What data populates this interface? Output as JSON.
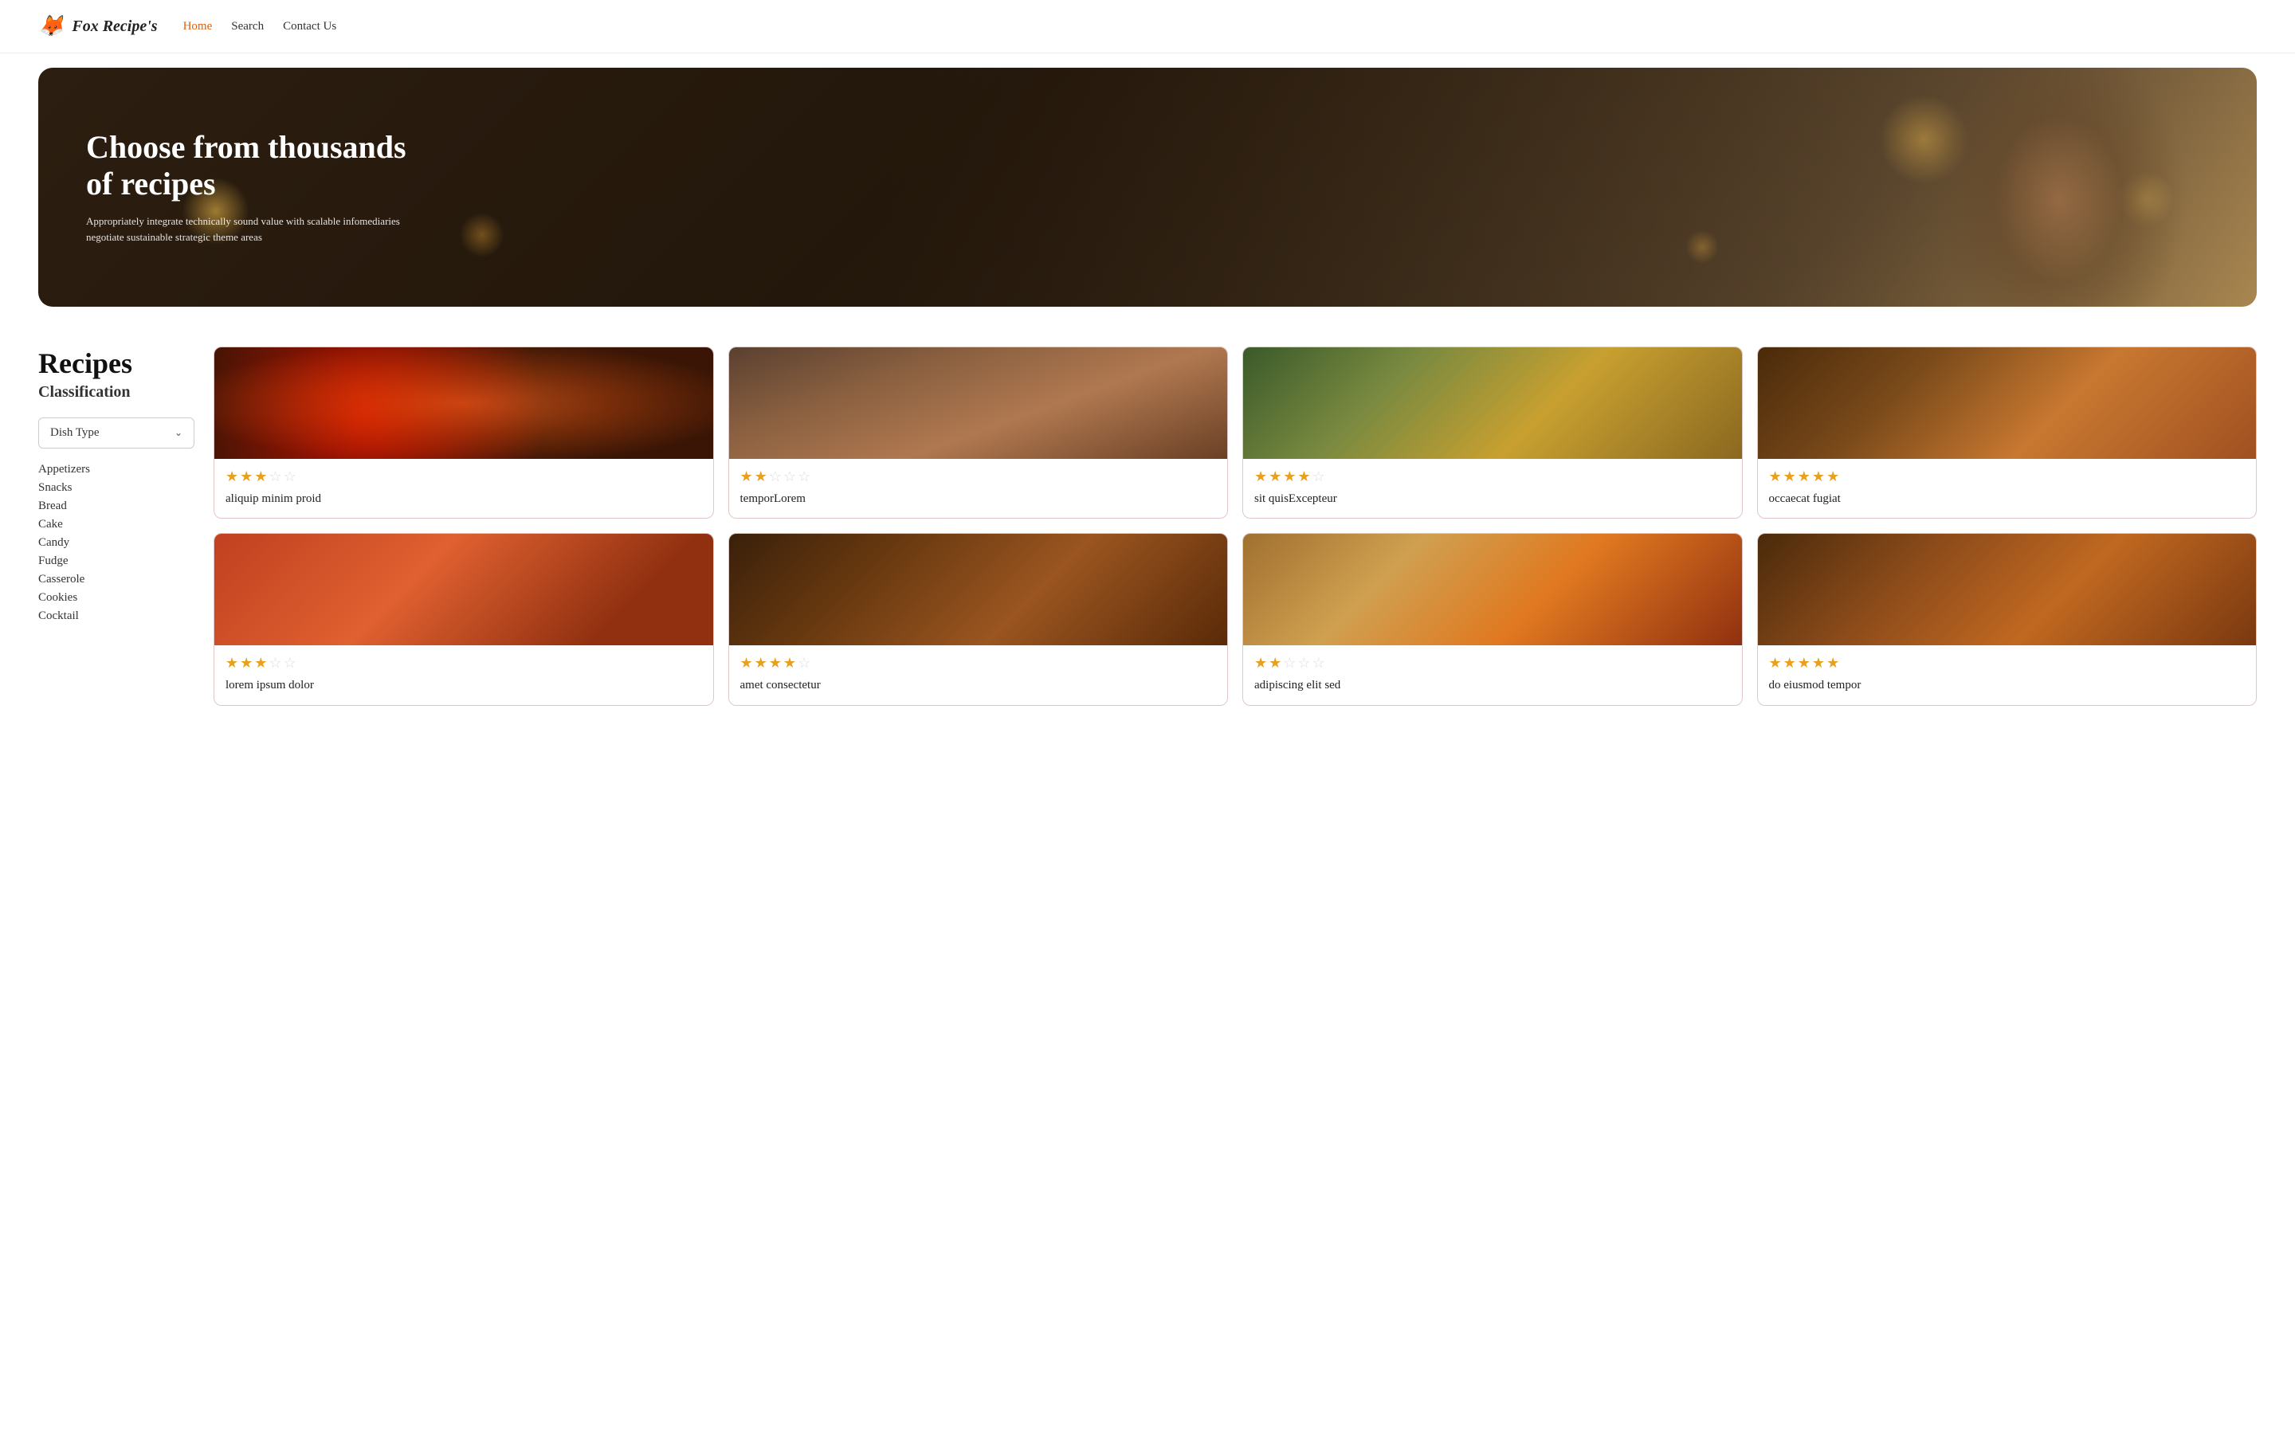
{
  "nav": {
    "logo_text": "Fox Recipe's",
    "links": [
      {
        "label": "Home",
        "active": true
      },
      {
        "label": "Search",
        "active": false
      },
      {
        "label": "Contact Us",
        "active": false
      }
    ]
  },
  "hero": {
    "title": "Choose from thousands of recipes",
    "subtitle": "Appropriately integrate technically sound value with scalable infomediaries negotiate sustainable strategic theme areas"
  },
  "sidebar": {
    "title": "Recipes",
    "subtitle": "Classification",
    "filter_label": "Dish Type",
    "categories": [
      "Appetizers",
      "Snacks",
      "Bread",
      "Cake",
      "Candy",
      "Fudge",
      "Casserole",
      "Cookies",
      "Cocktail"
    ]
  },
  "recipes": [
    {
      "title": "aliquip minim proid",
      "stars": 3,
      "img_class": "food-img-1"
    },
    {
      "title": "temporLorem",
      "stars": 2,
      "img_class": "food-img-2"
    },
    {
      "title": "sit quisExcepteur",
      "stars": 4,
      "img_class": "food-img-3"
    },
    {
      "title": "occaecat fugiat",
      "stars": 5,
      "img_class": "food-img-4"
    },
    {
      "title": "lorem ipsum dolor",
      "stars": 3,
      "img_class": "food-img-5"
    },
    {
      "title": "amet consectetur",
      "stars": 4,
      "img_class": "food-img-6"
    },
    {
      "title": "adipiscing elit sed",
      "stars": 2,
      "img_class": "food-img-7"
    },
    {
      "title": "do eiusmod tempor",
      "stars": 5,
      "img_class": "food-img-8"
    }
  ],
  "icons": {
    "fox": "🦊",
    "chevron_down": "⌄",
    "star_filled": "★",
    "star_empty": "☆"
  }
}
